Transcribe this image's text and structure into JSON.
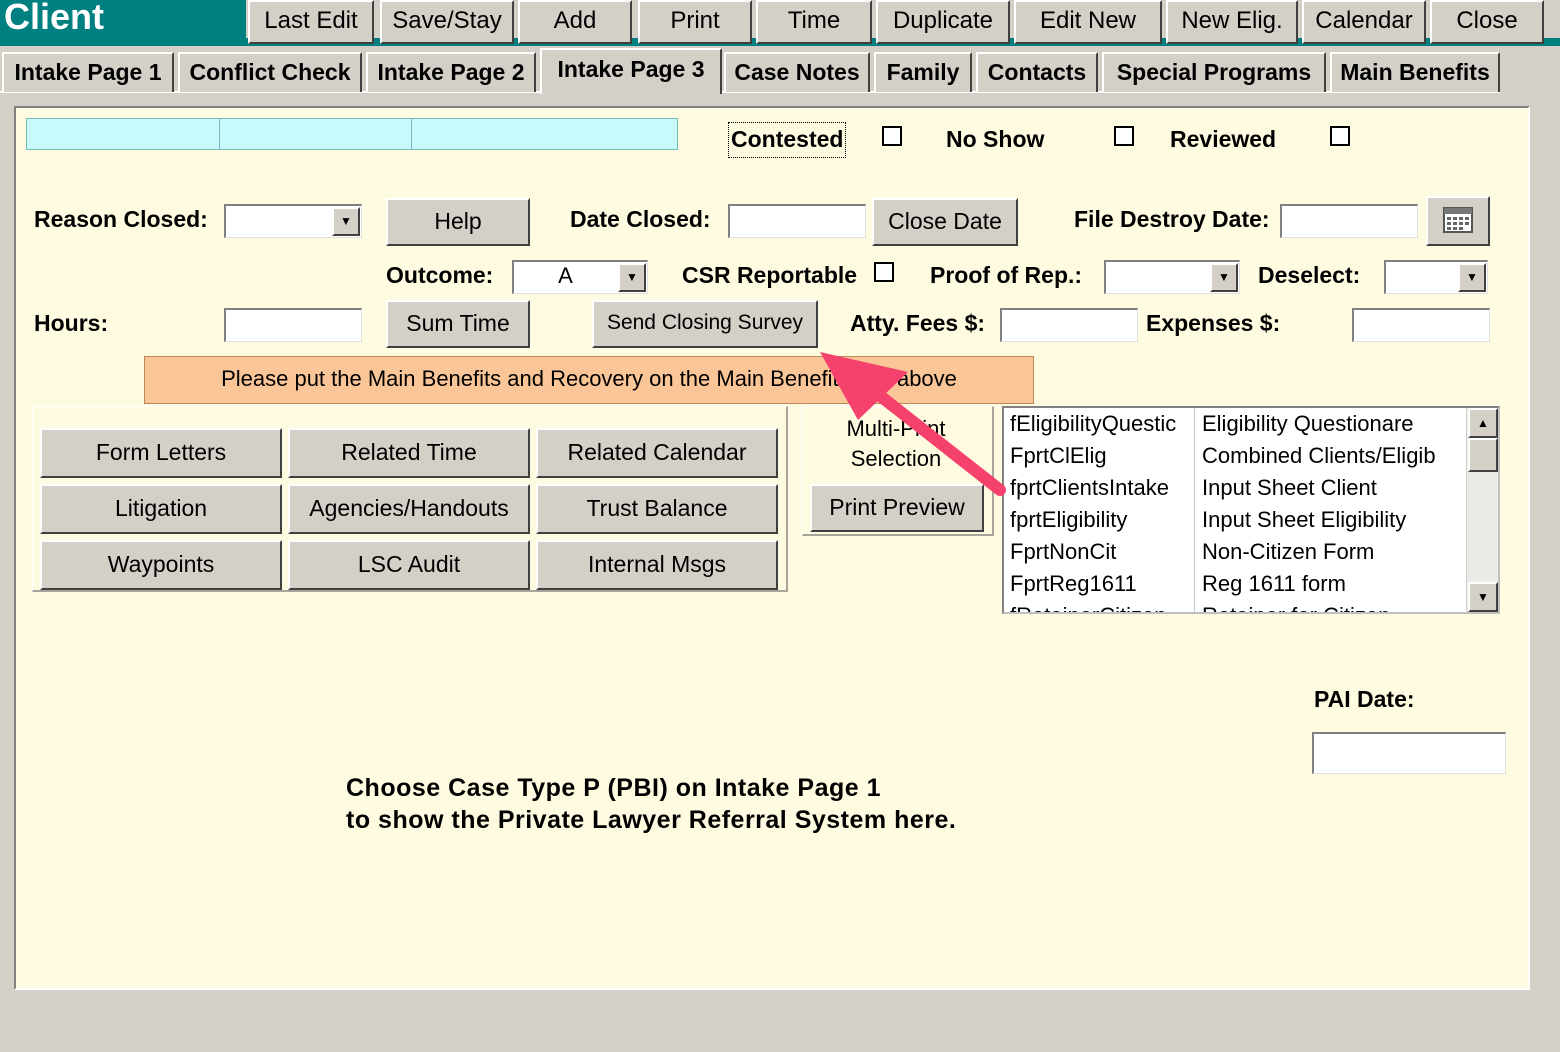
{
  "window": {
    "title": "Client"
  },
  "toolbar": [
    {
      "key": "last-edit",
      "label": "Last Edit"
    },
    {
      "key": "save-stay",
      "label": "Save/Stay"
    },
    {
      "key": "add",
      "label": "Add"
    },
    {
      "key": "print",
      "label": "Print"
    },
    {
      "key": "time",
      "label": "Time"
    },
    {
      "key": "duplicate",
      "label": "Duplicate"
    },
    {
      "key": "edit-new",
      "label": "Edit New"
    },
    {
      "key": "new-elig",
      "label": "New Elig."
    },
    {
      "key": "calendar",
      "label": "Calendar"
    },
    {
      "key": "close",
      "label": "Close"
    }
  ],
  "tabs": [
    {
      "key": "intake-page-1",
      "label": "Intake Page 1",
      "active": false
    },
    {
      "key": "conflict-check",
      "label": "Conflict Check",
      "active": false
    },
    {
      "key": "intake-page-2",
      "label": "Intake Page 2",
      "active": false
    },
    {
      "key": "intake-page-3",
      "label": "Intake Page 3",
      "active": true
    },
    {
      "key": "case-notes",
      "label": "Case Notes",
      "active": false
    },
    {
      "key": "family",
      "label": "Family",
      "active": false
    },
    {
      "key": "contacts",
      "label": "Contacts",
      "active": false
    },
    {
      "key": "special-programs",
      "label": "Special Programs",
      "active": false
    },
    {
      "key": "main-benefits",
      "label": "Main Benefits",
      "active": false
    }
  ],
  "flags": {
    "contested": {
      "label": "Contested",
      "checked": false
    },
    "no_show": {
      "label": "No Show",
      "checked": false
    },
    "reviewed": {
      "label": "Reviewed",
      "checked": false
    }
  },
  "closing": {
    "reason_closed_label": "Reason Closed:",
    "reason_closed_value": "",
    "help_button": "Help",
    "date_closed_label": "Date Closed:",
    "date_closed_value": "",
    "close_date_button": "Close Date",
    "file_destroy_label": "File Destroy Date:",
    "file_destroy_value": "",
    "outcome_label": "Outcome:",
    "outcome_value": "A",
    "csr_reportable_label": "CSR Reportable",
    "csr_reportable_checked": false,
    "proof_of_rep_label": "Proof of Rep.:",
    "proof_of_rep_value": "",
    "deselect_label": "Deselect:",
    "deselect_value": "",
    "hours_label": "Hours:",
    "hours_value": "",
    "sum_time_button": "Sum Time",
    "send_survey_button": "Send Closing Survey",
    "atty_fees_label": "Atty. Fees $:",
    "atty_fees_value": "",
    "expenses_label": "Expenses $:",
    "expenses_value": ""
  },
  "notice": "Please put the Main Benefits and Recovery on the Main Benefits Tab above",
  "action_buttons": [
    {
      "key": "form-letters",
      "label": "Form Letters"
    },
    {
      "key": "related-time",
      "label": "Related Time"
    },
    {
      "key": "related-calendar",
      "label": "Related Calendar"
    },
    {
      "key": "litigation",
      "label": "Litigation"
    },
    {
      "key": "agencies-handouts",
      "label": "Agencies/Handouts"
    },
    {
      "key": "trust-balance",
      "label": "Trust Balance"
    },
    {
      "key": "waypoints",
      "label": "Waypoints"
    },
    {
      "key": "lsc-audit",
      "label": "LSC Audit"
    },
    {
      "key": "internal-msgs",
      "label": "Internal Msgs"
    }
  ],
  "multi_print": {
    "label_line1": "Multi-Print",
    "label_line2": "Selection",
    "preview_button": "Print Preview"
  },
  "report_list": [
    {
      "name": "fEligibilityQuestic",
      "desc": "Eligibility Questionare"
    },
    {
      "name": "FprtClElig",
      "desc": "Combined Clients/Eligib"
    },
    {
      "name": "fprtClientsIntake",
      "desc": "Input Sheet Client"
    },
    {
      "name": "fprtEligibility",
      "desc": "Input Sheet Eligibility"
    },
    {
      "name": "FprtNonCit",
      "desc": "Non-Citizen Form"
    },
    {
      "name": "FprtReg1611",
      "desc": "Reg 1611 form"
    },
    {
      "name": "fRetainerCitizen",
      "desc": "Retainer for Citizen"
    }
  ],
  "pai": {
    "label": "PAI Date:",
    "value": ""
  },
  "pbi_note": {
    "line1": "Choose Case Type P (PBI) on Intake Page 1",
    "line2": "to show the Private Lawyer Referral System here."
  },
  "colors": {
    "teal": "#008080",
    "panel": "#fffbe1",
    "cyan_bar": "#c8fafc",
    "notice": "#fbc697",
    "annotation_arrow": "#f5426c"
  },
  "icons": {
    "dropdown": "chevron-down-icon",
    "calendar_picker": "calendar-icon",
    "scroll_up": "arrow-up-icon",
    "scroll_down": "arrow-down-icon",
    "annotation": "pink-arrow-icon"
  }
}
